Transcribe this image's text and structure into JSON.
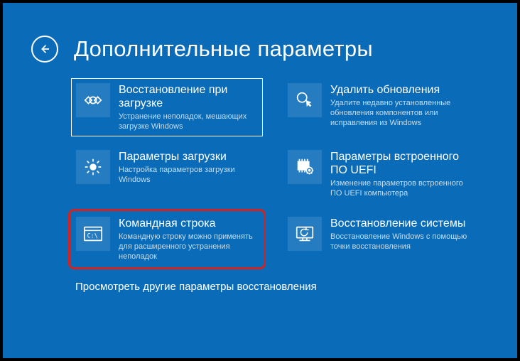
{
  "header": {
    "title": "Дополнительные параметры"
  },
  "tiles": [
    {
      "title": "Восстановление при загрузке",
      "desc": "Устранение неполадок, мешающих загрузке Windows"
    },
    {
      "title": "Удалить обновления",
      "desc": "Удалите недавно установленные обновления компонентов или исправления из Windows"
    },
    {
      "title": "Параметры загрузки",
      "desc": "Настройка параметров загрузки Windows"
    },
    {
      "title": "Параметры встроенного ПО UEFI",
      "desc": "Изменение параметров встроенного ПО UEFI компьютера"
    },
    {
      "title": "Командная строка",
      "desc": "Командную строку можно применять для расширенного устранения неполадок"
    },
    {
      "title": "Восстановление системы",
      "desc": "Восстановление Windows с помощью точки восстановления"
    }
  ],
  "more_link": "Просмотреть другие параметры восстановления"
}
